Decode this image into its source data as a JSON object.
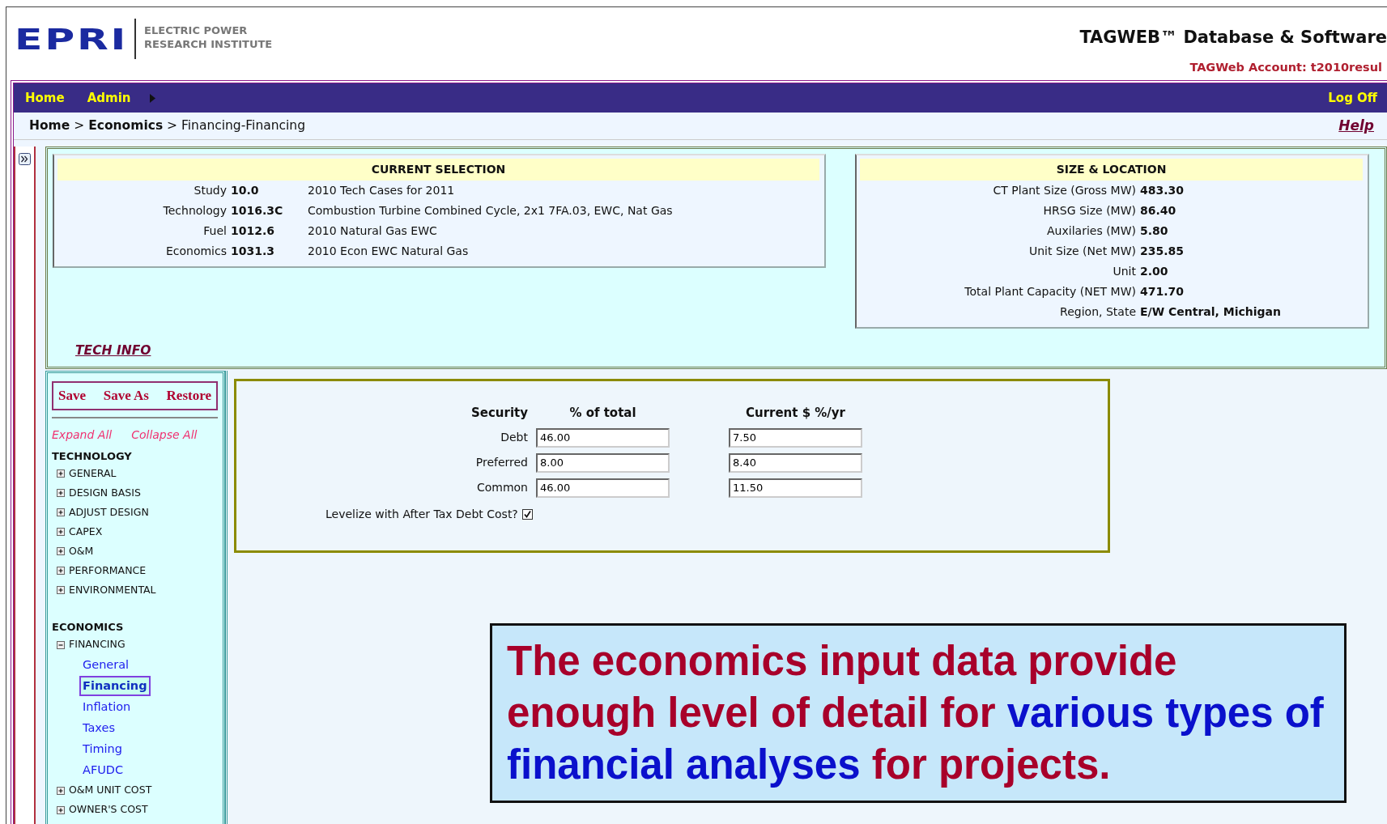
{
  "header": {
    "logo_mark": "EPRI",
    "logo_lines": [
      "ELECTRIC POWER",
      "RESEARCH INSTITUTE"
    ],
    "app_title": "TAGWEB™ Database & Software",
    "account": "TAGWeb Account: t2010resul"
  },
  "nav": {
    "items": [
      "Home",
      "Admin"
    ],
    "logoff": "Log Off"
  },
  "breadcrumb": {
    "path": "**Home** > **Economics** > Financing-Financing",
    "help": "Help"
  },
  "current_selection": {
    "title": "CURRENT SELECTION",
    "rows": [
      {
        "label": "Study",
        "code": "10.0",
        "description": "2010 Tech Cases for 2011"
      },
      {
        "label": "Technology",
        "code": "1016.3C",
        "description": "Combustion Turbine Combined Cycle, 2x1 7FA.03, EWC, Nat Gas"
      },
      {
        "label": "Fuel",
        "code": "1012.6",
        "description": "2010 Natural Gas EWC"
      },
      {
        "label": "Economics",
        "code": "1031.3",
        "description": "2010 Econ EWC Natural Gas"
      }
    ]
  },
  "size_location": {
    "title": "SIZE & LOCATION",
    "rows": [
      {
        "label": "CT Plant Size (Gross MW)",
        "value": "483.30"
      },
      {
        "label": "HRSG Size (MW)",
        "value": "86.40"
      },
      {
        "label": "Auxilaries (MW)",
        "value": "5.80"
      },
      {
        "label": "Unit Size (Net MW)",
        "value": "235.85"
      },
      {
        "label": "Unit",
        "value": "2.00"
      },
      {
        "label": "Total Plant Capacity (NET MW)",
        "value": "471.70"
      },
      {
        "label": "Region, State",
        "value": "E/W Central, Michigan"
      }
    ]
  },
  "tech_info": "TECH INFO",
  "toolbar": [
    "Save",
    "Save As",
    "Restore"
  ],
  "tree_actions": [
    "Expand All",
    "Collapse All"
  ],
  "tree": [
    {
      "title": "TECHNOLOGY",
      "items": [
        {
          "label": "GENERAL",
          "expanded": false
        },
        {
          "label": "DESIGN BASIS",
          "expanded": false
        },
        {
          "label": "ADJUST DESIGN",
          "expanded": false
        },
        {
          "label": "CAPEX",
          "expanded": false
        },
        {
          "label": "O&M",
          "expanded": false
        },
        {
          "label": "PERFORMANCE",
          "expanded": false
        },
        {
          "label": "ENVIRONMENTAL",
          "expanded": false
        }
      ]
    },
    {
      "title": "ECONOMICS",
      "items": [
        {
          "label": "FINANCING",
          "expanded": true,
          "children": [
            {
              "label": "General",
              "selected": false
            },
            {
              "label": "Financing",
              "selected": true
            },
            {
              "label": "Inflation",
              "selected": false
            },
            {
              "label": "Taxes",
              "selected": false
            },
            {
              "label": "Timing",
              "selected": false
            },
            {
              "label": "AFUDC",
              "selected": false
            }
          ]
        },
        {
          "label": "O&M UNIT COST",
          "expanded": false
        },
        {
          "label": "OWNER'S COST",
          "expanded": false
        }
      ]
    }
  ],
  "form": {
    "headers": [
      "Security",
      "% of total",
      "Current $ %/yr"
    ],
    "rows": [
      {
        "label": "Debt",
        "percent": "46.00",
        "rate": "7.50"
      },
      {
        "label": "Preferred",
        "percent": "8.00",
        "rate": "8.40"
      },
      {
        "label": "Common",
        "percent": "46.00",
        "rate": "11.50"
      }
    ],
    "levelize": {
      "label": "Levelize with After Tax Debt Cost?",
      "checked": true
    }
  },
  "callout": {
    "segments": [
      {
        "kind": "plain",
        "text": "The economics input data provide enough level of detail for"
      },
      {
        "kind": "emphasis",
        "text": "various types of financial analyses"
      },
      {
        "kind": "plain",
        "text": "for projects."
      }
    ]
  }
}
